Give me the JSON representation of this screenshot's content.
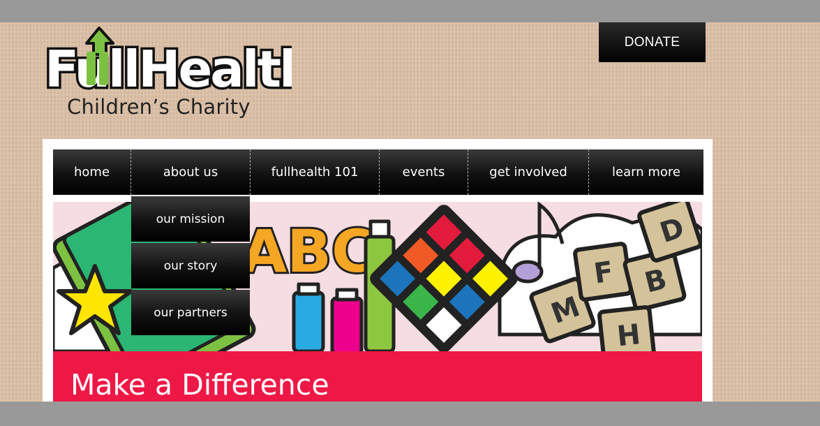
{
  "header": {
    "logo_brand": "FullHealth",
    "logo_tagline": "Children’s Charity",
    "donate_label": "DONATE"
  },
  "nav": {
    "items": [
      {
        "label": "home"
      },
      {
        "label": "about us"
      },
      {
        "label": "fullhealth 101"
      },
      {
        "label": "events"
      },
      {
        "label": "get involved"
      },
      {
        "label": "learn more"
      }
    ],
    "about_dropdown": [
      {
        "label": "our mission"
      },
      {
        "label": "our story"
      },
      {
        "label": "our partners"
      }
    ]
  },
  "hero": {
    "blocks_letters": [
      "ABC",
      "M",
      "F",
      "B",
      "D",
      "H"
    ],
    "banner_title": "Make a Difference"
  },
  "colors": {
    "brand_green": "#7dc142",
    "banner_red": "#ee1846",
    "nav_black": "#000000",
    "page_tan": "#dcc0a6"
  }
}
